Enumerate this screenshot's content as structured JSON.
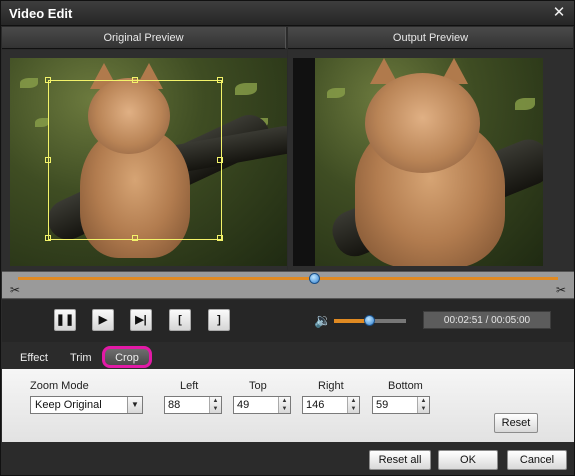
{
  "window": {
    "title": "Video Edit",
    "close_glyph": "✕"
  },
  "preview": {
    "original_label": "Original Preview",
    "output_label": "Output Preview"
  },
  "timeline": {
    "position_fraction": 0.55
  },
  "controls": {
    "pause_glyph": "❚❚",
    "play_glyph": "▶",
    "step_glyph": "▶|",
    "mark_in_glyph": "[",
    "mark_out_glyph": "]",
    "volume_icon": "🔉",
    "volume_fraction": 0.5,
    "time_text": "00:02:51 / 00:05:00"
  },
  "tabs": [
    {
      "label": "Effect"
    },
    {
      "label": "Trim"
    },
    {
      "label": "Crop"
    }
  ],
  "crop": {
    "zoom_mode_label": "Zoom Mode",
    "zoom_mode_value": "Keep Original",
    "left_label": "Left",
    "left_value": "88",
    "top_label": "Top",
    "top_value": "49",
    "right_label": "Right",
    "right_value": "146",
    "bottom_label": "Bottom",
    "bottom_value": "59",
    "reset_label": "Reset"
  },
  "footer": {
    "reset_all_label": "Reset all",
    "ok_label": "OK",
    "cancel_label": "Cancel"
  },
  "colors": {
    "accent": "#e08a22",
    "crop_tab_highlight": "#e21aa6",
    "crop_frame": "#f3f36a"
  }
}
